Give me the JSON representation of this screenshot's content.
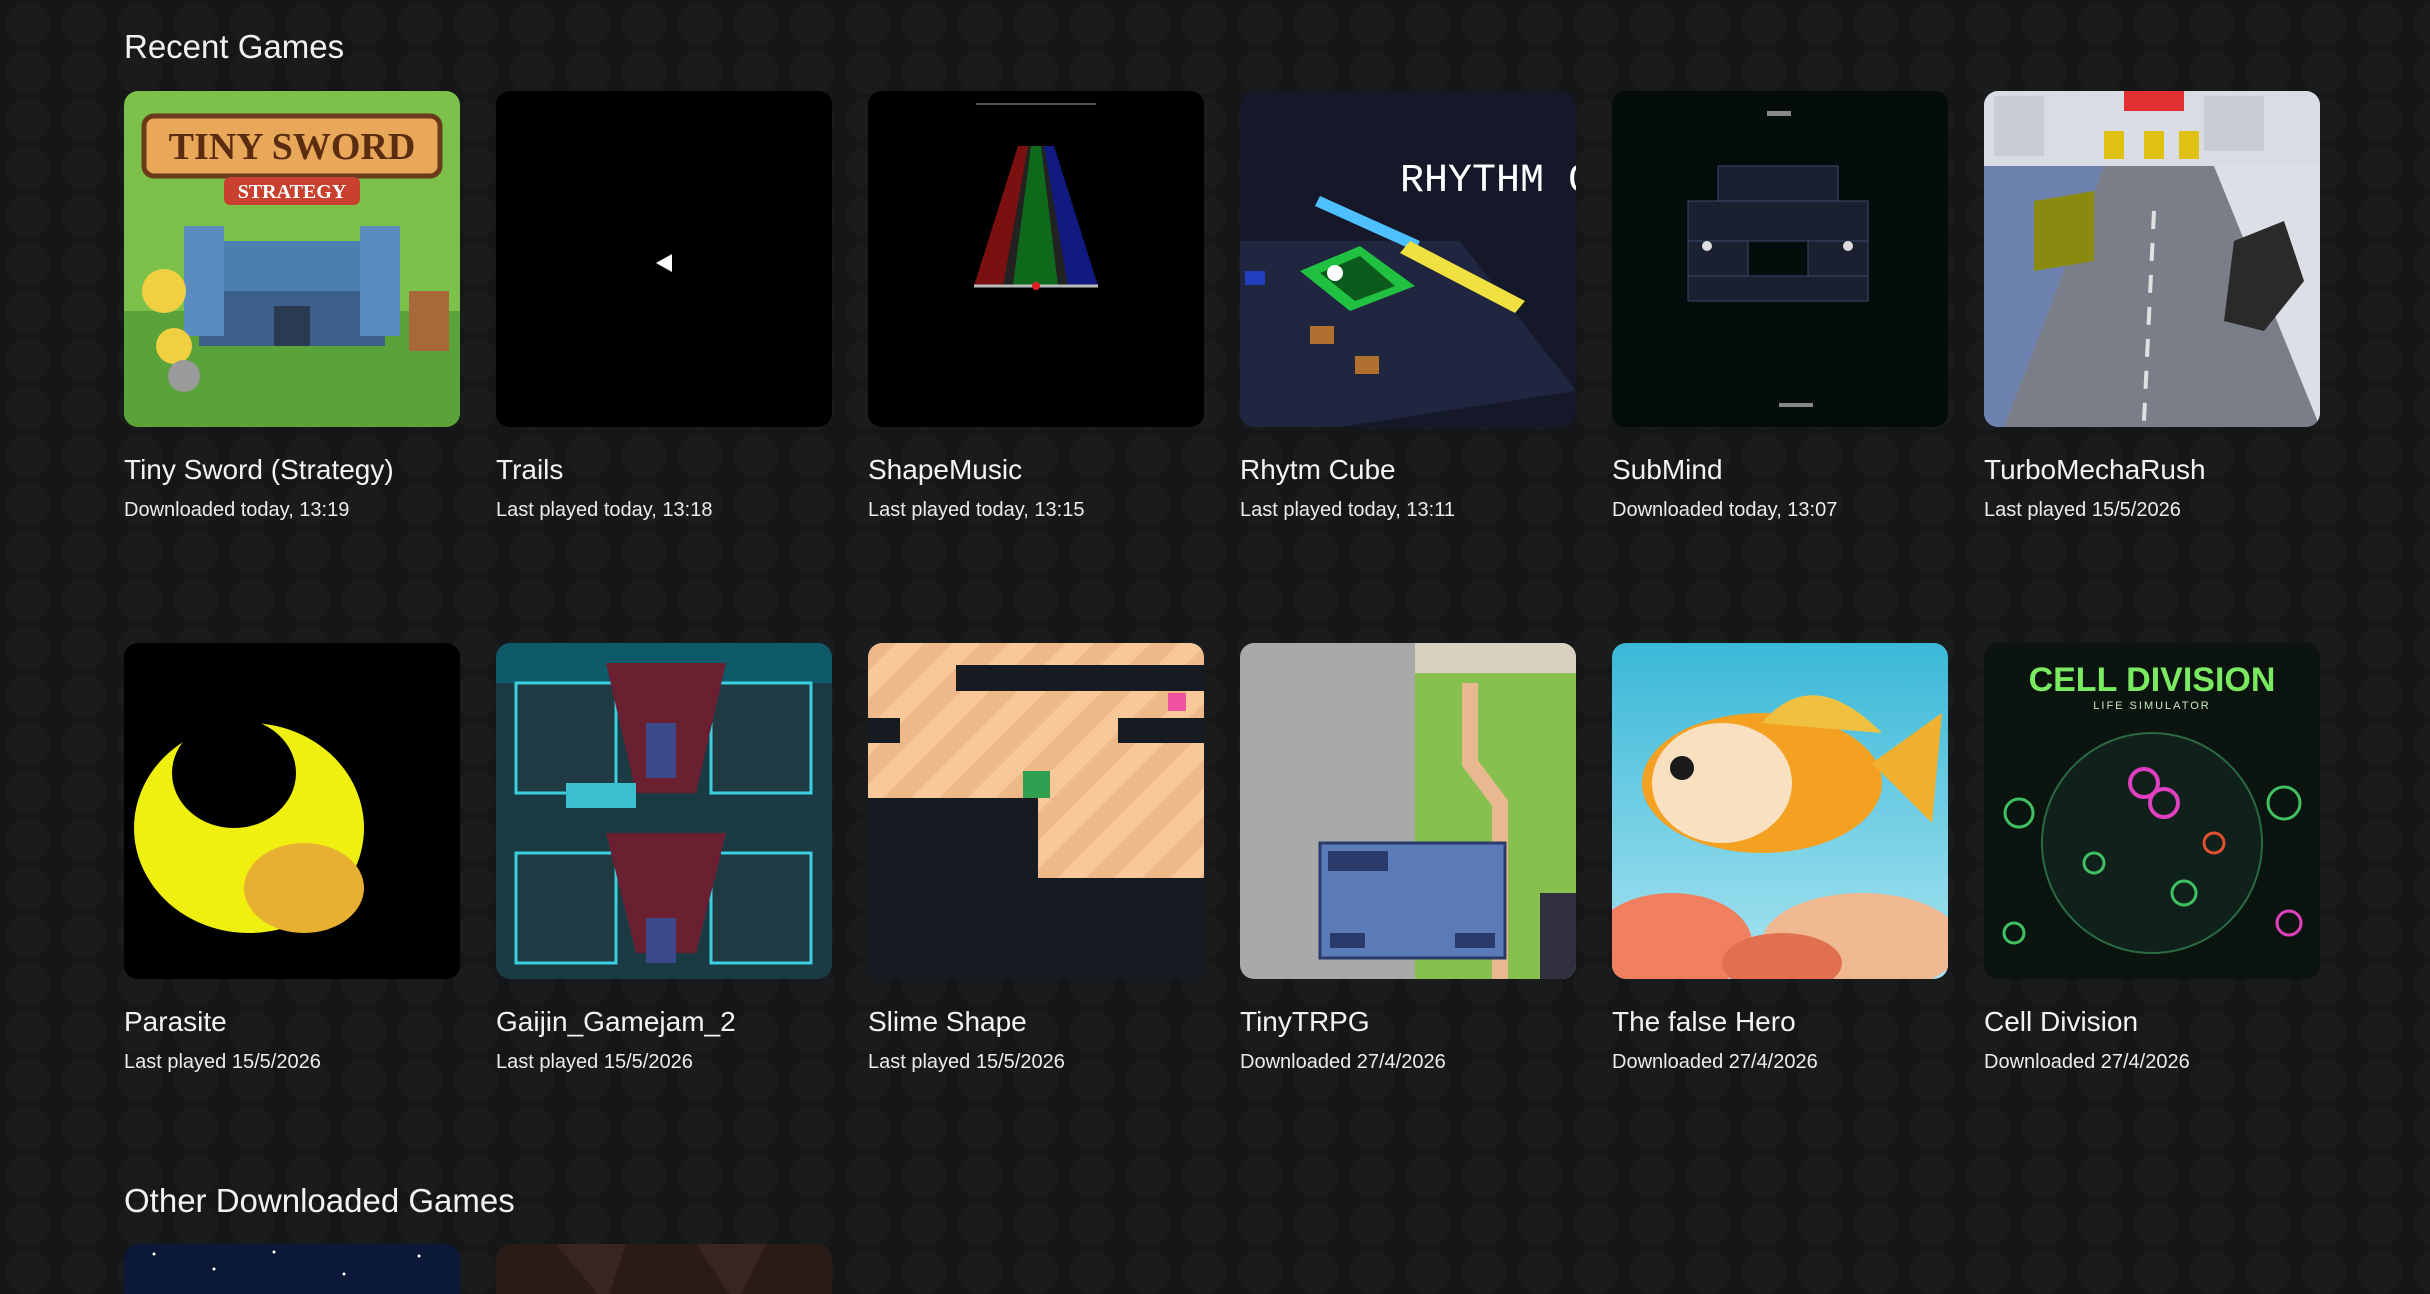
{
  "sections": {
    "recent_title": "Recent Games",
    "other_title": "Other Downloaded Games"
  },
  "recent_games": [
    {
      "title": "Tiny Sword (Strategy)",
      "status": "Downloaded today, 13:19",
      "thumb": "tiny-sword",
      "art_text": [
        "TINY SWORD",
        "STRATEGY"
      ]
    },
    {
      "title": "Trails",
      "status": "Last played today, 13:18",
      "thumb": "trails"
    },
    {
      "title": "ShapeMusic",
      "status": "Last played today, 13:15",
      "thumb": "shapemusic"
    },
    {
      "title": "Rhytm Cube",
      "status": "Last played today, 13:11",
      "thumb": "rhythm-cube",
      "art_text": [
        "RHYTHM C"
      ]
    },
    {
      "title": "SubMind",
      "status": "Downloaded today, 13:07",
      "thumb": "submind"
    },
    {
      "title": "TurboMechaRush",
      "status": "Last played 15/5/2026",
      "thumb": "turbomecharush"
    },
    {
      "title": "Parasite",
      "status": "Last played 15/5/2026",
      "thumb": "parasite"
    },
    {
      "title": "Gaijin_Gamejam_2",
      "status": "Last played 15/5/2026",
      "thumb": "gaijin"
    },
    {
      "title": "Slime Shape",
      "status": "Last played 15/5/2026",
      "thumb": "slime-shape"
    },
    {
      "title": "TinyTRPG",
      "status": "Downloaded 27/4/2026",
      "thumb": "tinytrpg"
    },
    {
      "title": "The false Hero",
      "status": "Downloaded 27/4/2026",
      "thumb": "false-hero"
    },
    {
      "title": "Cell Division",
      "status": "Downloaded 27/4/2026",
      "thumb": "cell-division",
      "art_text": [
        "CELL DIVISION",
        "LIFE SIMULATOR"
      ]
    }
  ],
  "other_games": [
    {
      "thumb": "night-sky"
    },
    {
      "thumb": "dark-cave"
    }
  ],
  "colors": {
    "background": "#151617",
    "text": "#f4f4f4"
  }
}
